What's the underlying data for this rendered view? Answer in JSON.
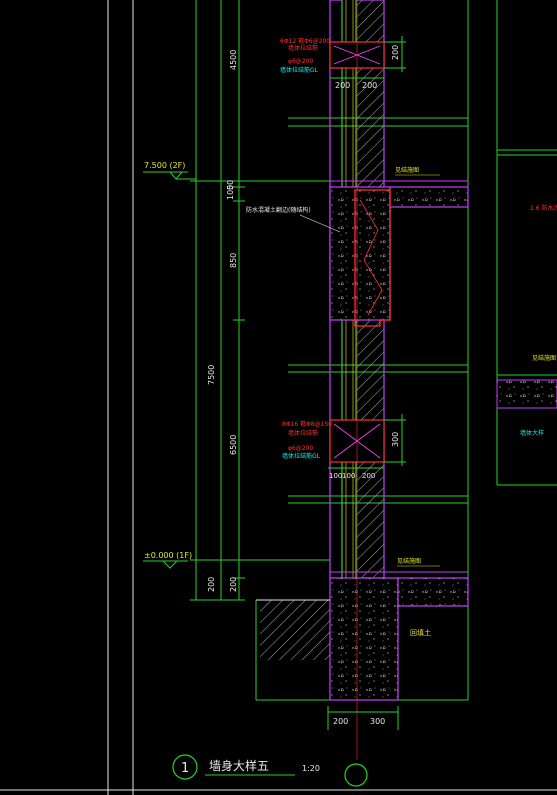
{
  "drawing": {
    "title": "墙身大样五",
    "scale": "1:20",
    "detail_number": "1",
    "levels": {
      "upper": "7.500  (2F)",
      "lower": "±0.000  (1F)"
    },
    "dimensions": {
      "top_height": "4500",
      "storey": "7500",
      "mid_height": "6500",
      "seg_850": "850",
      "seg_100": "100",
      "seg_50": "50",
      "slab_a": "200",
      "slab_b": "200",
      "wall_top_a": "200",
      "wall_top_b": "200",
      "lintel_top": "200",
      "lintel_mid": "300",
      "wall_mid_a": "100",
      "wall_mid_b": "100",
      "wall_mid_c": "200",
      "bottom_a": "200",
      "bottom_b": "300"
    },
    "annotations": {
      "lintel1_spec": "6Φ12 箍Φ6@200",
      "lintel1_line2": "墙体拉结筋",
      "lintel1_line3": "φ6@200",
      "lintel1_line4": "墙体拉结筋GL",
      "lintel2_spec": "8Φ16 箍Φ8@150",
      "lintel2_line2": "墙体拉结筋",
      "lintel2_line3": "φ6@200",
      "lintel2_line4": "墙体拉结筋GL",
      "beam_note": "防水混凝土翻边(随结构)",
      "slab_label_upper": "见结施图",
      "slab_label_lower": "见结施图",
      "ground_label": "回填土",
      "right_note": "1.6 防水涂料",
      "right_label1": "见结施图",
      "right_label2": "墙体大样"
    }
  }
}
